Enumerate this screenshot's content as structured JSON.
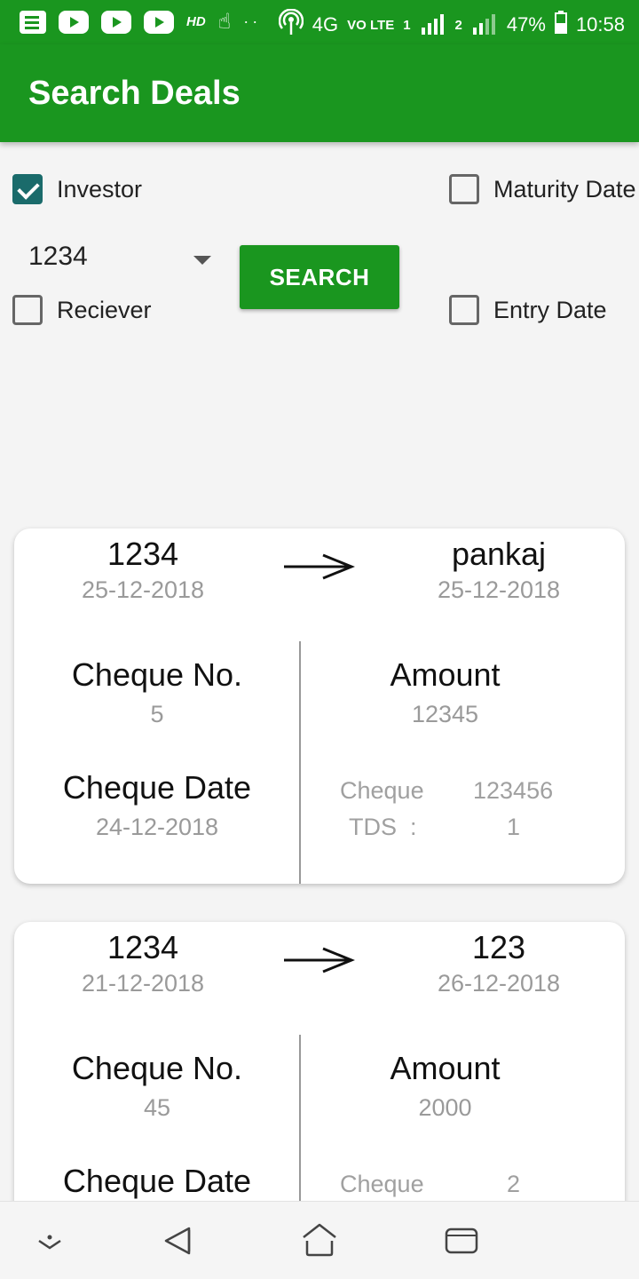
{
  "status_bar": {
    "hd": "HD",
    "dots": "··",
    "network": "4G",
    "volte": "VO LTE",
    "sim1": "1",
    "sim2": "2",
    "battery": "47%",
    "time": "10:58"
  },
  "app_bar": {
    "title": "Search Deals"
  },
  "filters": {
    "investor": {
      "label": "Investor",
      "checked": true
    },
    "maturity_date": {
      "label": "Maturity Date",
      "checked": false
    },
    "reciever": {
      "label": "Reciever",
      "checked": false
    },
    "entry_date": {
      "label": "Entry Date",
      "checked": false
    },
    "spinner_value": "1234",
    "search_label": "SEARCH"
  },
  "deals": [
    {
      "from_name": "1234",
      "from_date": "25-12-2018",
      "to_name": "pankaj",
      "to_date": "25-12-2018",
      "cheque_no_label": "Cheque No.",
      "cheque_no": "5",
      "amount_label": "Amount",
      "amount": "12345",
      "cheque_date_label": "Cheque Date",
      "cheque_date": "24-12-2018",
      "cheque_key": "Cheque",
      "cheque_val": "123456",
      "tds_key": "TDS  :",
      "tds_val": "1"
    },
    {
      "from_name": "1234",
      "from_date": "21-12-2018",
      "to_name": "123",
      "to_date": "26-12-2018",
      "cheque_no_label": "Cheque No.",
      "cheque_no": "45",
      "amount_label": "Amount",
      "amount": "2000",
      "cheque_date_label": "Cheque Date",
      "cheque_key": "Cheque",
      "cheque_val": "2"
    }
  ],
  "nav": {
    "icons": [
      "chevron-down-icon",
      "back-icon",
      "home-icon",
      "recents-icon"
    ]
  },
  "colors": {
    "primary": "#1a961f",
    "checkbox_checked": "#1a6b6b",
    "secondary_text": "#9a9a9a"
  }
}
